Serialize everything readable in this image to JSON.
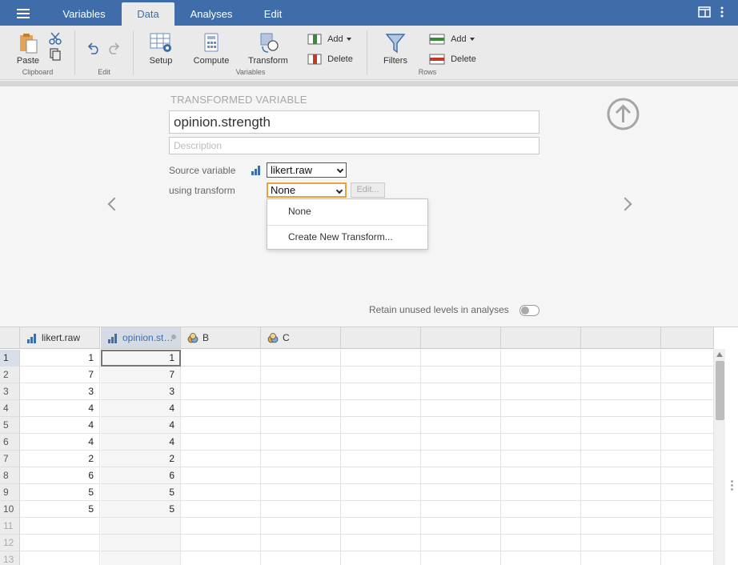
{
  "menu": {
    "tabs": [
      {
        "label": "Variables"
      },
      {
        "label": "Data"
      },
      {
        "label": "Analyses"
      },
      {
        "label": "Edit"
      }
    ]
  },
  "ribbon": {
    "paste": "Paste",
    "clipboard_group": "Clipboard",
    "edit_group": "Edit",
    "setup": "Setup",
    "compute": "Compute",
    "transform": "Transform",
    "variables_group": "Variables",
    "var_add": "Add",
    "var_delete": "Delete",
    "filters": "Filters",
    "row_add": "Add",
    "row_delete": "Delete",
    "rows_group": "Rows"
  },
  "setup": {
    "section_title": "TRANSFORMED VARIABLE",
    "name": "opinion.strength",
    "description_placeholder": "Description",
    "source_label": "Source variable",
    "source_value": "likert.raw",
    "transform_label": "using transform",
    "transform_value": "None",
    "edit_label": "Edit...",
    "dropdown_options": [
      "None",
      "Create New Transform..."
    ],
    "retain_label": "Retain unused levels in analyses",
    "retain_on": false
  },
  "grid": {
    "columns": [
      {
        "label": "likert.raw",
        "icon": "continuous-variable-icon"
      },
      {
        "label": "opinion.st…",
        "icon": "continuous-variable-icon"
      },
      {
        "label": "B",
        "icon": "nominal-variable-icon"
      },
      {
        "label": "C",
        "icon": "nominal-variable-icon"
      },
      {
        "label": ""
      },
      {
        "label": ""
      },
      {
        "label": ""
      },
      {
        "label": ""
      },
      {
        "label": ""
      }
    ],
    "row_numbers": [
      "1",
      "2",
      "3",
      "4",
      "5",
      "6",
      "7",
      "8",
      "9",
      "10",
      "11",
      "12",
      "13"
    ],
    "likert_raw": [
      "1",
      "7",
      "3",
      "4",
      "4",
      "4",
      "2",
      "6",
      "5",
      "5",
      "",
      "",
      ""
    ],
    "opinion_strength": [
      "1",
      "7",
      "3",
      "4",
      "4",
      "4",
      "2",
      "6",
      "5",
      "5",
      "",
      "",
      ""
    ]
  },
  "colors": {
    "accent": "#3e6da9",
    "focus": "#e8a33d",
    "delete_red": "#c0392b",
    "add_green": "#3a8a3a"
  }
}
